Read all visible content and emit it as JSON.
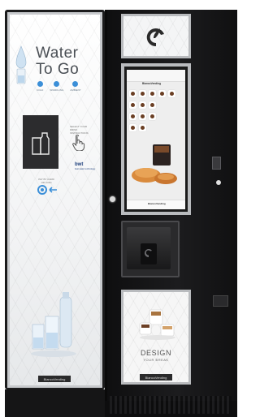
{
  "left_panel": {
    "title_line1": "Water",
    "title_line2": "To Go",
    "options": [
      "COLD",
      "SPARKLING",
      "AMBIENT"
    ],
    "instruction_text": "SELECT YOUR DRINK\nINSTRUCTIONS",
    "bwt_brand": "bwt",
    "bwt_sub": "best water technology",
    "tap_text": "PAY BY CARD\nOR COIN",
    "brand_plate": "BiancoVending"
  },
  "screen": {
    "brand": "BiancoVending",
    "footer": "BiancoVending"
  },
  "bottom_panel": {
    "headline": "DESIGN",
    "subline": "YOUR BREAK",
    "brand_plate": "BiancoVending"
  },
  "colors": {
    "cabinet": "#1b1b1c",
    "panel_frame": "#b9bbbe",
    "accent_blue": "#3b8fd8",
    "bwt_blue": "#1d3f7c"
  }
}
